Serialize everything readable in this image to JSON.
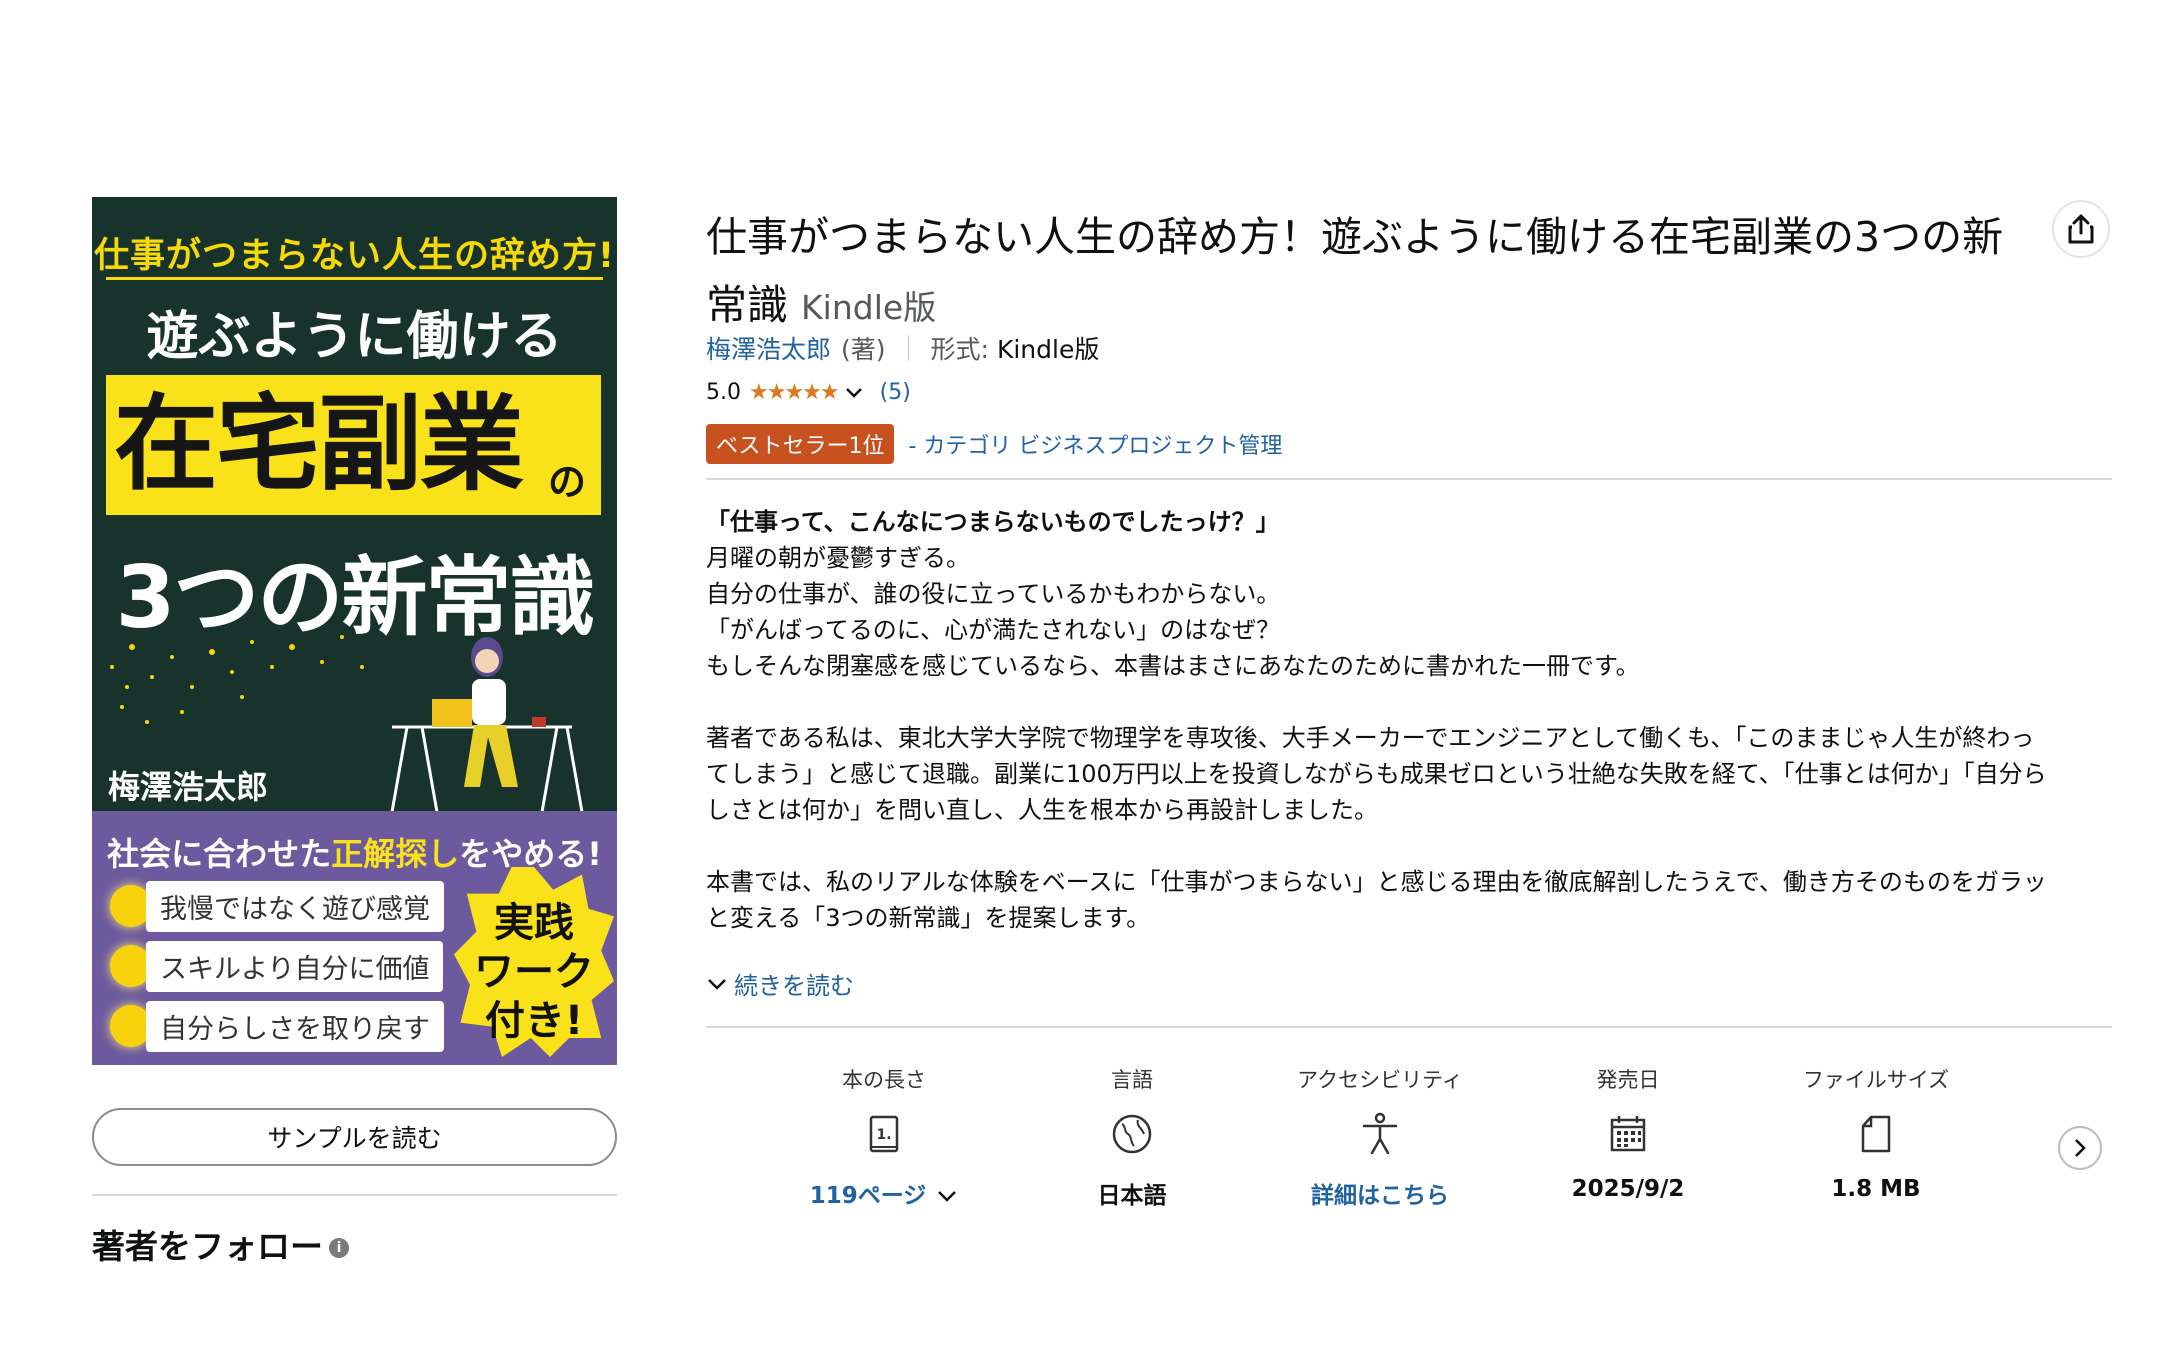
{
  "cover": {
    "top_line": "仕事がつまらない人生の辞め方!",
    "subtitle": "遊ぶように働ける",
    "main": "在宅副業",
    "main_suffix": "の",
    "line3": "3つの新常識",
    "author": "梅澤浩太郎",
    "purple_title_pre": "社会に合わせた",
    "purple_title_hl": "正解探し",
    "purple_title_post": "をやめる!",
    "bullets": [
      "我慢ではなく遊び感覚",
      "スキルより自分に価値",
      "自分らしさを取り戻す"
    ],
    "burst": [
      "実践",
      "ワーク",
      "付き!"
    ]
  },
  "left": {
    "sample_button": "サンプルを読む",
    "follow_title": "著者をフォロー",
    "info_icon": "i"
  },
  "product": {
    "title": "仕事がつまらない人生の辞め方！遊ぶように働ける在宅副業の3つの新常識",
    "format_tag": "Kindle版",
    "author": "梅澤浩太郎",
    "author_role": "(著)",
    "format_label": "形式:",
    "format_value": "Kindle版",
    "rating_value": "5.0",
    "rating_stars": "★★★★★",
    "rating_count": "(5)",
    "rating_fraction": 1.0,
    "bestseller_badge": "ベストセラー1位",
    "bestseller_category": "- カテゴリ ビジネスプロジェクト管理"
  },
  "description": {
    "lead": "「仕事って、こんなにつまらないものでしたっけ？」",
    "p1": [
      "月曜の朝が憂鬱すぎる。",
      "自分の仕事が、誰の役に立っているかもわからない。",
      "「がんばってるのに、心が満たされない」のはなぜ？",
      "もしそんな閉塞感を感じているなら、本書はまさにあなたのために書かれた一冊です。"
    ],
    "p2": [
      "著者である私は、東北大学大学院で物理学を専攻後、大手メーカーでエンジニアとして働くも、「このままじゃ人生が終わっ",
      "てしまう」と感じて退職。副業に100万円以上を投資しながらも成果ゼロという壮絶な失敗を経て、「仕事とは何か」「自分ら",
      "しさとは何か」を問い直し、人生を根本から再設計しました。"
    ],
    "p3": [
      "本書では、私のリアルな体験をベースに「仕事がつまらない」と感じる理由を徹底解剖したうえで、働き方そのものをガラッ",
      "と変える「3つの新常識」を提案します。"
    ],
    "read_more": "続きを読む"
  },
  "attributes": [
    {
      "label": "本の長さ",
      "icon": "book-page-icon",
      "value": "119ページ",
      "link": true,
      "chevron": true
    },
    {
      "label": "言語",
      "icon": "globe-icon",
      "value": "日本語",
      "link": false,
      "chevron": false
    },
    {
      "label": "アクセシビリティ",
      "icon": "accessibility-icon",
      "value": "詳細はこちら",
      "link": true,
      "chevron": false
    },
    {
      "label": "発売日",
      "icon": "calendar-icon",
      "value": "2025/9/2",
      "link": false,
      "chevron": false
    },
    {
      "label": "ファイルサイズ",
      "icon": "file-icon",
      "value": "1.8 MB",
      "link": false,
      "chevron": false
    }
  ],
  "colors": {
    "link": "#2162a1",
    "star": "#de7921",
    "badge": "#c7511f",
    "cover_bg": "#17332c",
    "cover_yellow": "#fae21b",
    "cover_purple": "#6d5a9e"
  }
}
